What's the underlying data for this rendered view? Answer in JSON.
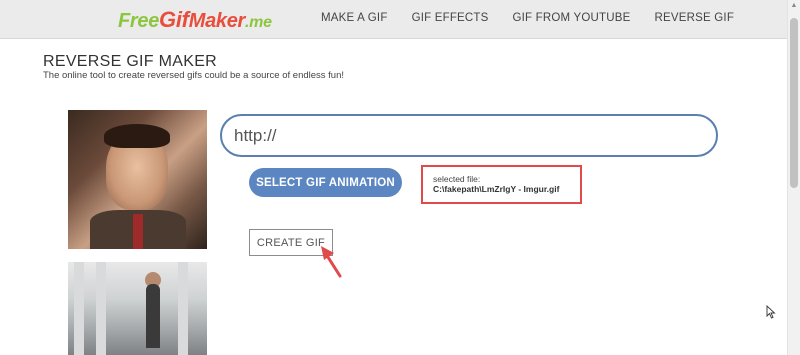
{
  "header": {
    "logo": {
      "free": "Free",
      "gif": "Gif",
      "maker": "Maker",
      "me": ".me"
    },
    "nav": [
      {
        "label": "MAKE A GIF"
      },
      {
        "label": "GIF EFFECTS"
      },
      {
        "label": "GIF FROM YOUTUBE"
      },
      {
        "label": "REVERSE GIF"
      }
    ]
  },
  "main": {
    "title": "REVERSE GIF MAKER",
    "subtitle": "The online tool to create reversed gifs could be a source of endless fun!",
    "url_input": {
      "placeholder": "http://"
    },
    "select_button": "SELECT GIF ANIMATION",
    "selected_file": {
      "label": "selected file:",
      "name": "C:\\fakepath\\LmZrIgY - Imgur.gif"
    },
    "create_button": "CREATE GIF"
  },
  "colors": {
    "accent_blue": "#5b86c2",
    "input_border": "#5a7fb0",
    "highlight_red": "#e04a4a",
    "logo_green": "#8cc63f",
    "logo_red": "#e94e3c"
  }
}
